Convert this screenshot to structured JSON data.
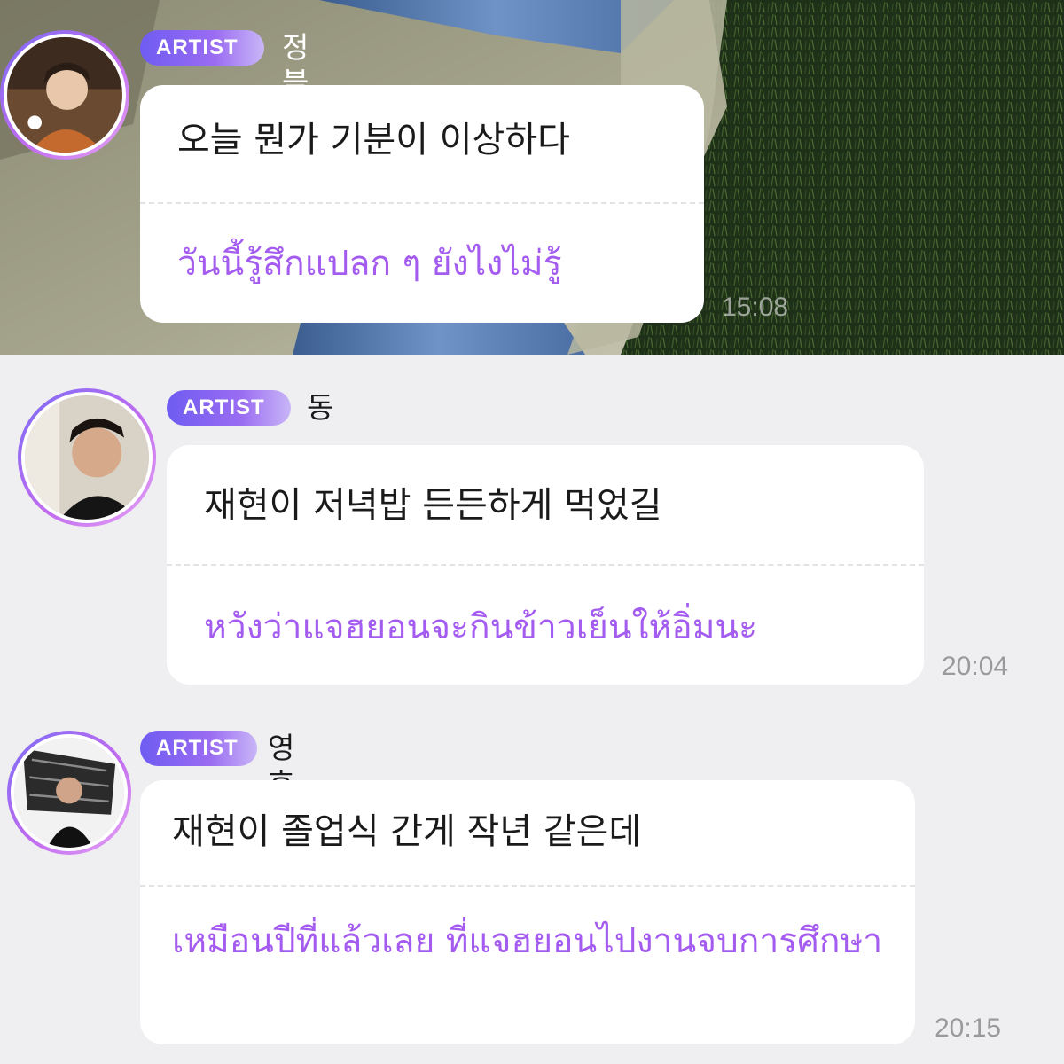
{
  "colors": {
    "badge_gradient_start": "#6f5cf2",
    "badge_gradient_end": "#c9b6f7",
    "translation_text": "#a45cf0",
    "bubble_background": "#ffffff",
    "chat_background": "#efeff1"
  },
  "messages": [
    {
      "badge": "ARTIST",
      "sender": "정블리",
      "original": "오늘 뭔가 기분이 이상하다",
      "translation": "วันนี้รู้สึกแปลก ๆ ยังไงไม่รู้",
      "time": "15:08",
      "avatar": "profile-photo"
    },
    {
      "badge": "ARTIST",
      "sender": "동",
      "original": "재현이 저녁밥 든든하게 먹었길",
      "translation": "หวังว่าแจฮยอนจะกินข้าวเย็นให้อิ่มนะ",
      "time": "20:04",
      "avatar": "profile-photo"
    },
    {
      "badge": "ARTIST",
      "sender": "영호",
      "original": "재현이 졸업식 간게 작년 같은데",
      "translation": "เหมือนปีที่แล้วเลย ที่แจฮยอนไปงานจบการศึกษา",
      "time": "20:15",
      "avatar": "profile-photo"
    }
  ]
}
